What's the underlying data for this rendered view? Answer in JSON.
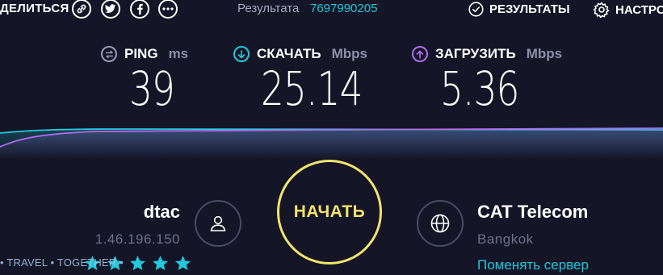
{
  "header": {
    "share_label": "ДЕЛИТЬСЯ",
    "share_icons": [
      "link-icon",
      "twitter-icon",
      "facebook-icon",
      "more-icon"
    ],
    "result_label": "Результата",
    "result_id": "7697990205",
    "results_label": "РЕЗУЛЬТАТЫ",
    "settings_label": "НАСТРО"
  },
  "metrics": {
    "ping": {
      "label": "PING",
      "unit": "ms",
      "value": "39",
      "icon": "ping-icon",
      "color": "#9a9cb3"
    },
    "download": {
      "label": "СКАЧАТЬ",
      "unit": "Mbps",
      "value": "25.14",
      "icon": "download-arrow-icon",
      "color": "#23c8dc"
    },
    "upload": {
      "label": "ЗАГРУЗИТЬ",
      "unit": "Mbps",
      "value": "5.36",
      "icon": "upload-arrow-icon",
      "color": "#b16ef0"
    }
  },
  "isp": {
    "name": "dtac",
    "ip": "1.46.196.150",
    "rating_stars": 5,
    "icon": "user-icon"
  },
  "go_button": {
    "label": "НАЧАТЬ",
    "color": "#f2e46b"
  },
  "server": {
    "name": "CAT Telecom",
    "city": "Bangkok",
    "change_label": "Поменять сервер",
    "icon": "globe-icon"
  },
  "watermark": "• TRAVEL • TOGETHER •",
  "colors": {
    "background": "#141526",
    "accent_cyan": "#23c8dc",
    "accent_purple": "#b16ef0",
    "accent_yellow": "#f2e46b"
  }
}
